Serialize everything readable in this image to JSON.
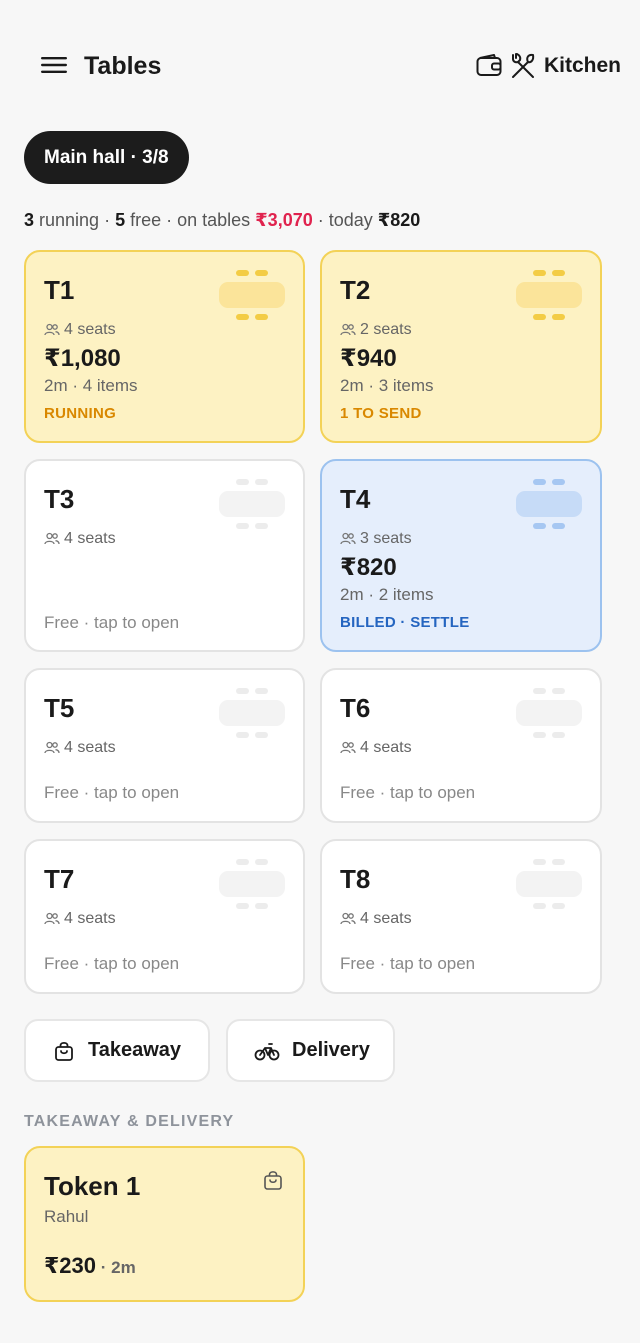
{
  "header": {
    "title": "Tables",
    "kitchen_label": "Kitchen",
    "icons": [
      "menu-icon",
      "wallet-icon",
      "utensils-icon"
    ]
  },
  "hall": {
    "label": "Main hall · 3/8"
  },
  "summary": {
    "running_count": "3",
    "running_label": " running · ",
    "free_count": "5",
    "free_label": " free · on tables ",
    "on_tables_amount": "₹3,070",
    "today_label": " · today ",
    "today_amount": "₹820"
  },
  "tables": [
    {
      "name": "T1",
      "seats": "4 seats",
      "amount": "₹1,080",
      "meta": "2m · 4 items",
      "status": "RUNNING",
      "state": "running"
    },
    {
      "name": "T2",
      "seats": "2 seats",
      "amount": "₹940",
      "meta": "2m · 3 items",
      "status": "1 TO SEND",
      "state": "running"
    },
    {
      "name": "T3",
      "seats": "4 seats",
      "free_text": "Free · tap to open",
      "state": "free"
    },
    {
      "name": "T4",
      "seats": "3 seats",
      "amount": "₹820",
      "meta": "2m · 2 items",
      "status": "BILLED · SETTLE",
      "state": "billed"
    },
    {
      "name": "T5",
      "seats": "4 seats",
      "free_text": "Free · tap to open",
      "state": "free"
    },
    {
      "name": "T6",
      "seats": "4 seats",
      "free_text": "Free · tap to open",
      "state": "free"
    },
    {
      "name": "T7",
      "seats": "4 seats",
      "free_text": "Free · tap to open",
      "state": "free"
    },
    {
      "name": "T8",
      "seats": "4 seats",
      "free_text": "Free · tap to open",
      "state": "free"
    }
  ],
  "order_buttons": {
    "takeaway": "Takeaway",
    "delivery": "Delivery"
  },
  "takeaway_section": {
    "heading": "TAKEAWAY & DELIVERY",
    "tokens": [
      {
        "name": "Token 1",
        "customer": "Rahul",
        "amount": "₹230",
        "time": " · 2m"
      }
    ]
  },
  "colors": {
    "running_bg": "#fdf2c3",
    "running_border": "#f3d257",
    "running_status": "#d98800",
    "billed_bg": "#e5eefc",
    "billed_border": "#9cc2ef",
    "billed_status": "#2565c0",
    "highlight_amount": "#e0234e",
    "chip_bg": "#1c1c1c"
  }
}
